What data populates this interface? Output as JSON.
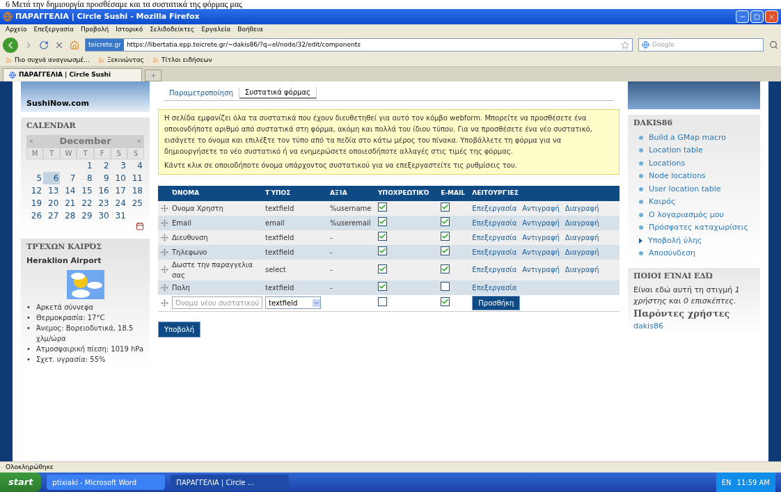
{
  "document_caption": "6 Μετά την δημιουργία προσθέσαμε και τα συστατικά της φόρμας μας",
  "window": {
    "title": "ΠΑΡΑΓΓΕΛΙΑ | Circle Sushi - Mozilla Firefox"
  },
  "menu": [
    "Αρχείο",
    "Επεξεργασία",
    "Προβολή",
    "Ιστορικό",
    "Σελιδοδείκτες",
    "Εργαλεία",
    "Βοήθεια"
  ],
  "toolbar": {
    "site_badge": "teicrete.gr",
    "url": "https://libertatia.epp.teicrete.gr/~dakis86/?q=el/node/32/edit/components",
    "search_placeholder": "Google"
  },
  "bookmarks": [
    "Πιο συχνά αναγνωσμέ...",
    "Ξεκινώντας",
    "Τίτλοι ειδήσεων"
  ],
  "tabs": [
    {
      "label": "ΠΑΡΑΓΓΕΛΙΑ | Circle Sushi",
      "selected": true
    }
  ],
  "left_sidebar": {
    "logo": "SushiNow.com",
    "calendar": {
      "title": "CALENDAR",
      "prev": "«",
      "month": "December",
      "next": "»",
      "weekdays": [
        "M",
        "T",
        "W",
        "T",
        "F",
        "S",
        "S"
      ],
      "weeks": [
        [
          {
            "label": "1",
            "selected": false
          },
          {
            "label": "2",
            "selected": false
          },
          {
            "label": "3",
            "selected": false
          },
          {
            "label": "4",
            "selected": false
          }
        ],
        [
          {
            "label": "5",
            "selected": false
          },
          {
            "label": "6",
            "selected": true
          },
          {
            "label": "7",
            "selected": false
          },
          {
            "label": "8",
            "selected": false
          },
          {
            "label": "9",
            "selected": false
          },
          {
            "label": "10",
            "selected": false
          },
          {
            "label": "11",
            "selected": false
          }
        ],
        [
          {
            "label": "12",
            "selected": false
          },
          {
            "label": "13",
            "selected": false
          },
          {
            "label": "14",
            "selected": false
          },
          {
            "label": "15",
            "selected": false
          },
          {
            "label": "16",
            "selected": false
          },
          {
            "label": "17",
            "selected": false
          },
          {
            "label": "18",
            "selected": false
          }
        ],
        [
          {
            "label": "19",
            "selected": false
          },
          {
            "label": "20",
            "selected": false
          },
          {
            "label": "21",
            "selected": false
          },
          {
            "label": "22",
            "selected": false
          },
          {
            "label": "23",
            "selected": false
          },
          {
            "label": "24",
            "selected": false
          },
          {
            "label": "25",
            "selected": false
          }
        ],
        [
          {
            "label": "26",
            "selected": false
          },
          {
            "label": "27",
            "selected": false
          },
          {
            "label": "28",
            "selected": false
          },
          {
            "label": "29",
            "selected": false
          },
          {
            "label": "30",
            "selected": false
          },
          {
            "label": "31",
            "selected": false
          }
        ]
      ]
    },
    "weather": {
      "title": "ΤΡΈΧΩΝ ΚΑΙΡΌΣ",
      "bullet": "•",
      "station": "Heraklion Airport",
      "conditions": [
        "Αρκετά σύννεφα",
        "Θερμοκρασία: 17°C",
        "Άνεμος: Βορειοδυτικά, 18.5 χλμ/ώρα",
        "Ατμοσφαιρική πίεση: 1019 hPa",
        "Σχετ. υγρασία: 55%"
      ]
    }
  },
  "page_tabs": [
    {
      "label": "Παραμετροποίηση",
      "selected": false
    },
    {
      "label": "Συστατικά φόρμας",
      "selected": true
    }
  ],
  "help_text": [
    "Η σελίδα εμφανίζει όλα τα συστατικά που έχουν διευθετηθεί για αυτό τον κόμβο webform. Μπορείτε να προσθέσετε ένα οποιονδήποτε αριθμό από συστατικά στη φόρμα, ακόμη και πολλά του ίδιου τύπου. Για να προσθέσετε ένα νέο συστατικό, εισάγετε το όνομα και επιλέξτε τον τύπο από τα πεδία στο κάτω μέρος του πίνακα. Υποβάλλετε τη φόρμα για να δημιουργήσετε το νέο συστατικό ή να ενημερώσετε οποιεσδήποτε αλλαγές στις τιμές της φόρμας.",
    "Κάντε κλικ σε οποιοδήποτε όνομα υπάρχοντος συστατικού για να επεξεργαστείτε τις ρυθμίσεις του."
  ],
  "components_table": {
    "columns": [
      "ΌΝΟΜΑ",
      "ΤΎΠΟΣ",
      "ΑΞΊΑ",
      "ΥΠΟΧΡΕΩΤΙΚΌ",
      "E-MAIL",
      "ΛΕΙΤΟΥΡΓΊΕΣ"
    ],
    "rows": [
      {
        "name": "Ονομα Χρηστη",
        "type": "textfield",
        "value": "%username",
        "required": true,
        "email": true,
        "actions": [
          "Επεξεργασία",
          "Αντιγραφή",
          "Διαγραφή"
        ]
      },
      {
        "name": "Email",
        "type": "email",
        "value": "%useremail",
        "required": true,
        "email": true,
        "actions": [
          "Επεξεργασία",
          "Αντιγραφή",
          "Διαγραφή"
        ]
      },
      {
        "name": "Διευθυνση",
        "type": "textfield",
        "value": "-",
        "required": true,
        "email": true,
        "actions": [
          "Επεξεργασία",
          "Αντιγραφή",
          "Διαγραφή"
        ]
      },
      {
        "name": "Τηλεφωνο",
        "type": "textfield",
        "value": "-",
        "required": true,
        "email": true,
        "actions": [
          "Επεξεργασία",
          "Αντιγραφή",
          "Διαγραφή"
        ]
      },
      {
        "name": "Δωστε την παραγγελια σας",
        "type": "select",
        "value": "-",
        "required": true,
        "email": true,
        "actions": [
          "Επεξεργασία",
          "Αντιγραφή",
          "Διαγραφή"
        ]
      },
      {
        "name": "Πολη",
        "type": "textfield",
        "value": "-",
        "required": true,
        "email": false,
        "actions": [
          "Επεξεργασία"
        ]
      }
    ],
    "new_row": {
      "placeholder": "Όνομα νέου συστατικού",
      "type": "textfield",
      "required": false,
      "email": true,
      "button": "Προσθήκη"
    }
  },
  "submit": "Υποβολή",
  "right_sidebar": {
    "user_menu": {
      "title": "DAKIS86",
      "items": [
        {
          "label": "Build a GMap macro",
          "kind": "leaf"
        },
        {
          "label": "Location table",
          "kind": "leaf"
        },
        {
          "label": "Locations",
          "kind": "leaf"
        },
        {
          "label": "Node locations",
          "kind": "leaf"
        },
        {
          "label": "User location table",
          "kind": "leaf"
        },
        {
          "label": "Καιρός",
          "kind": "leaf"
        },
        {
          "label": "Ο λογαριασμός μου",
          "kind": "leaf"
        },
        {
          "label": "Πρόσφατες καταχωρίσεις",
          "kind": "leaf"
        },
        {
          "label": "Υποβολή ύλης",
          "kind": "collapsed"
        },
        {
          "label": "Αποσύνδεση",
          "kind": "leaf"
        }
      ]
    },
    "who_is_online": {
      "title": "ΠΟΙΟΙ ΕΊΝΑΙ ΕΔΏ",
      "text": "Είναι εδώ αυτή τη στιγμή *1 χρήστης* και *0 επισκέπτες*.",
      "subtitle": "Παρόντες χρήστες",
      "users": [
        "dakis86"
      ]
    }
  },
  "status_bar": {
    "text": "Ολοκληρώθηκε"
  },
  "taskbar": {
    "start": "start",
    "tasks": [
      {
        "label": "ptixiaki - Microsoft Word",
        "selected": false
      },
      {
        "label": "ΠΑΡΑΓΓΕΛΙΑ | Circle ...",
        "selected": true
      }
    ],
    "language": "EN",
    "clock": "11:59 AM"
  }
}
